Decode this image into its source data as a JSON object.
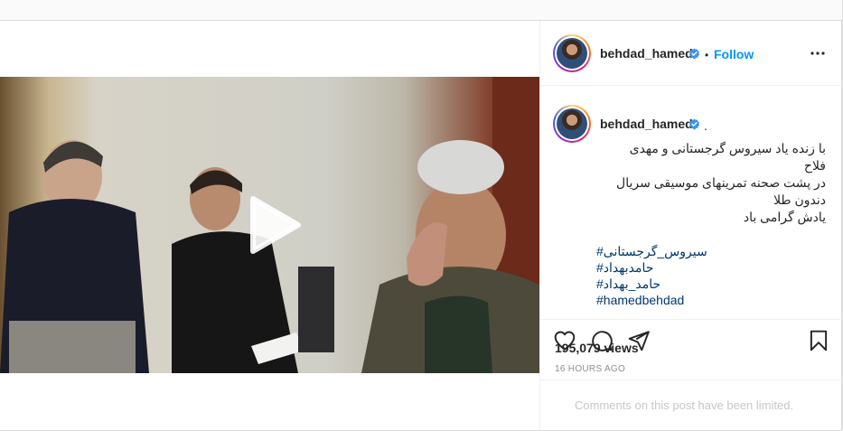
{
  "post": {
    "username": "behdad_hamed",
    "follow_separator": "•",
    "follow_label": "Follow",
    "caption_trailing": ".",
    "caption_lines": [
      "با زنده یاد سیروس گرجستانی و مهدی",
      "فلاح",
      "در پشت صحنه تمرینهای موسیقی سریال",
      "دندون طلا",
      "یادش گرامی باد"
    ],
    "hashtags": [
      "#سیروس_گرجستانی",
      "#حامدبهداد",
      "#حامد_بهداد",
      "#hamedbehdad"
    ],
    "views": "195,079 views",
    "timestamp": "16 HOURS AGO",
    "comments_notice": "Comments on this post have been limited."
  },
  "icons": {
    "verified": "verified-badge-icon",
    "more": "more-options-icon",
    "like": "heart-icon",
    "comment": "comment-icon",
    "share": "share-icon",
    "save": "bookmark-icon",
    "play": "play-icon"
  },
  "colors": {
    "link": "#0095f6",
    "hashtag": "#00376b",
    "muted": "#8e8e8e",
    "border": "#dbdbdb"
  }
}
